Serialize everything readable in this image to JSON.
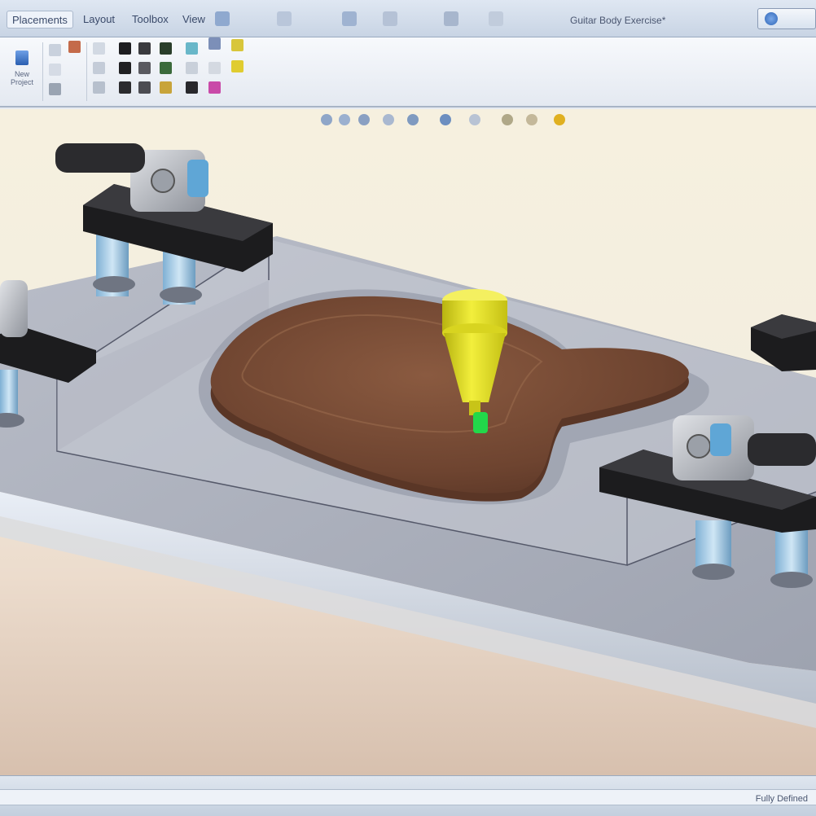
{
  "app": {
    "title": "Guitar Body Exercise*"
  },
  "ribbon_tabs": [
    {
      "label": "Placements"
    },
    {
      "label": "Layout"
    },
    {
      "label": "Toolbox"
    },
    {
      "label": "View"
    }
  ],
  "ribbon": {
    "big_button_label": "New Project"
  },
  "status": {
    "text": "Fully Defined"
  },
  "colors": {
    "accent": "#2f66b8",
    "tool_yellow": "#e4e21c",
    "tool_tip_green": "#22d84a",
    "stock_wood": "#7a4a32",
    "fixture_black": "#1c1c1e",
    "post_blue": "#9cc8e6"
  },
  "icons": {
    "help": "help-icon",
    "new_project": "new-project-icon"
  }
}
